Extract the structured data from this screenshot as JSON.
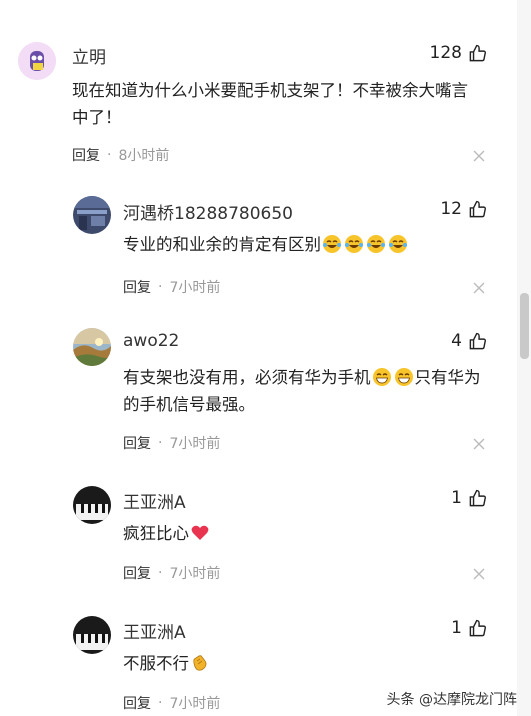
{
  "comments": [
    {
      "author": "立明",
      "likes": "128",
      "text": "现在知道为什么小米要配手机支架了！不幸被余大嘴言中了！",
      "reply_label": "回复",
      "separator": "·",
      "time": "8小时前"
    },
    {
      "author": "河遇桥18288780650",
      "likes": "12",
      "text": "专业的和业余的肯定有区别",
      "reply_label": "回复",
      "separator": "·",
      "time": "7小时前"
    },
    {
      "author": "awo22",
      "likes": "4",
      "text_part1": "有支架也没有用，必须有华为手机",
      "text_part2": "只有华为的手机信号最强。",
      "reply_label": "回复",
      "separator": "·",
      "time": "7小时前"
    },
    {
      "author": "王亚洲A",
      "likes": "1",
      "text": "疯狂比心",
      "reply_label": "回复",
      "separator": "·",
      "time": "7小时前"
    },
    {
      "author": "王亚洲A",
      "likes": "1",
      "text": "不服不行",
      "reply_label": "回复",
      "separator": "·",
      "time": "7小时前"
    }
  ],
  "watermark": "头条 @达摩院龙门阵",
  "icons": {
    "like": "thumbs-up-icon",
    "close": "close-icon",
    "laugh_cry": "laugh-cry-emoji",
    "grin": "grin-emoji",
    "heart": "heart-emoji",
    "clap": "clap-emoji"
  },
  "colors": {
    "text": "#222222",
    "meta": "#999999",
    "background": "#ffffff"
  }
}
